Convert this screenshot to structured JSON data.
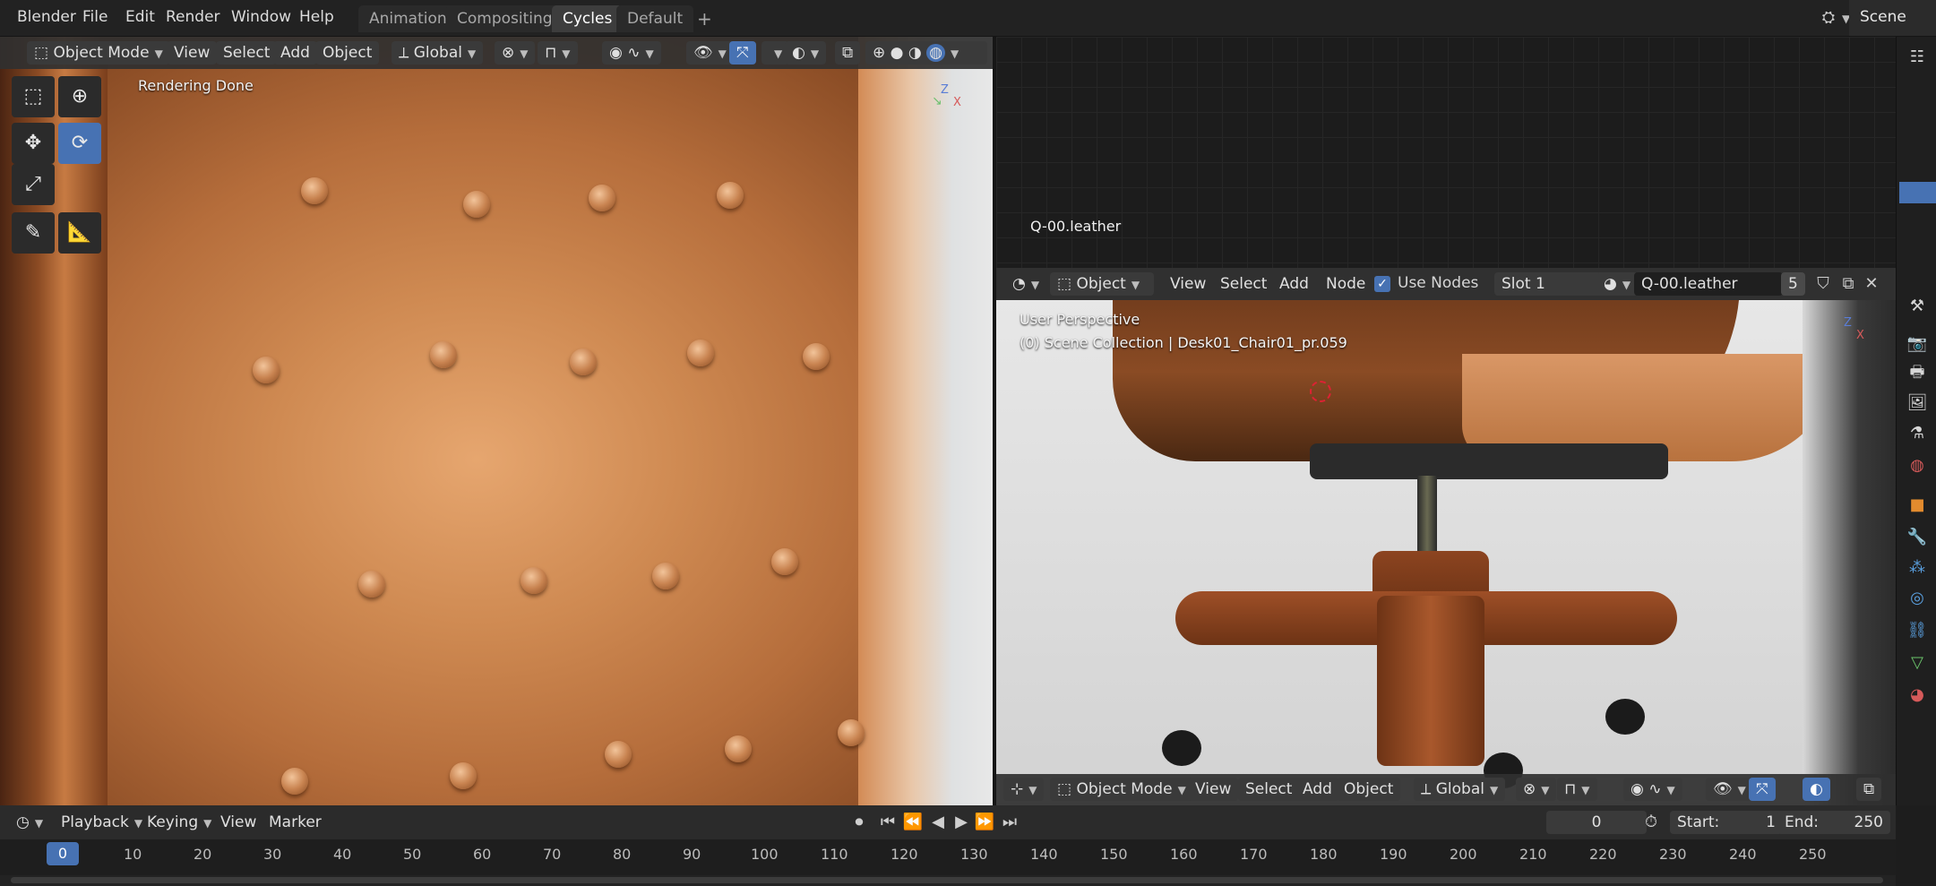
{
  "menu": [
    "Blender",
    "File",
    "Edit",
    "Render",
    "Window",
    "Help"
  ],
  "workspaces": [
    "Animation",
    "Compositing",
    "Cycles",
    "Default"
  ],
  "active_workspace": "Cycles",
  "add_workspace": "+",
  "scene": "Scene",
  "left_viewport": {
    "mode": "Object Mode",
    "menus": [
      "View",
      "Select",
      "Add",
      "Object"
    ],
    "orientation": "Global",
    "status": "Rendering Done",
    "axis_z": "Z",
    "axis_x": "X"
  },
  "node_editor": {
    "material_label": "Q-00.leather",
    "editor": "Object",
    "menus": [
      "View",
      "Select",
      "Add",
      "Node"
    ],
    "use_nodes": "Use Nodes",
    "slot": "Slot 1",
    "material": "Q-00.leather",
    "users": "5"
  },
  "right_viewport": {
    "title": "User Perspective",
    "collection": "(0) Scene Collection | Desk01_Chair01_pr.059",
    "mode": "Object Mode",
    "menus": [
      "View",
      "Select",
      "Add",
      "Object"
    ],
    "orientation": "Global",
    "axis_z": "Z",
    "axis_x": "X"
  },
  "timeline": {
    "menus": [
      "Playback",
      "Keying",
      "View",
      "Marker"
    ],
    "current_frame": "0",
    "start_label": "Start:",
    "start": "1",
    "end_label": "End:",
    "end": "250",
    "ticks": [
      "0",
      "10",
      "20",
      "30",
      "40",
      "50",
      "60",
      "70",
      "80",
      "90",
      "100",
      "110",
      "120",
      "130",
      "140",
      "150",
      "160",
      "170",
      "180",
      "190",
      "200",
      "210",
      "220",
      "230",
      "240",
      "250"
    ]
  },
  "colors": {
    "accent": "#4772b3",
    "header": "#303030",
    "background": "#1d1d1d"
  }
}
